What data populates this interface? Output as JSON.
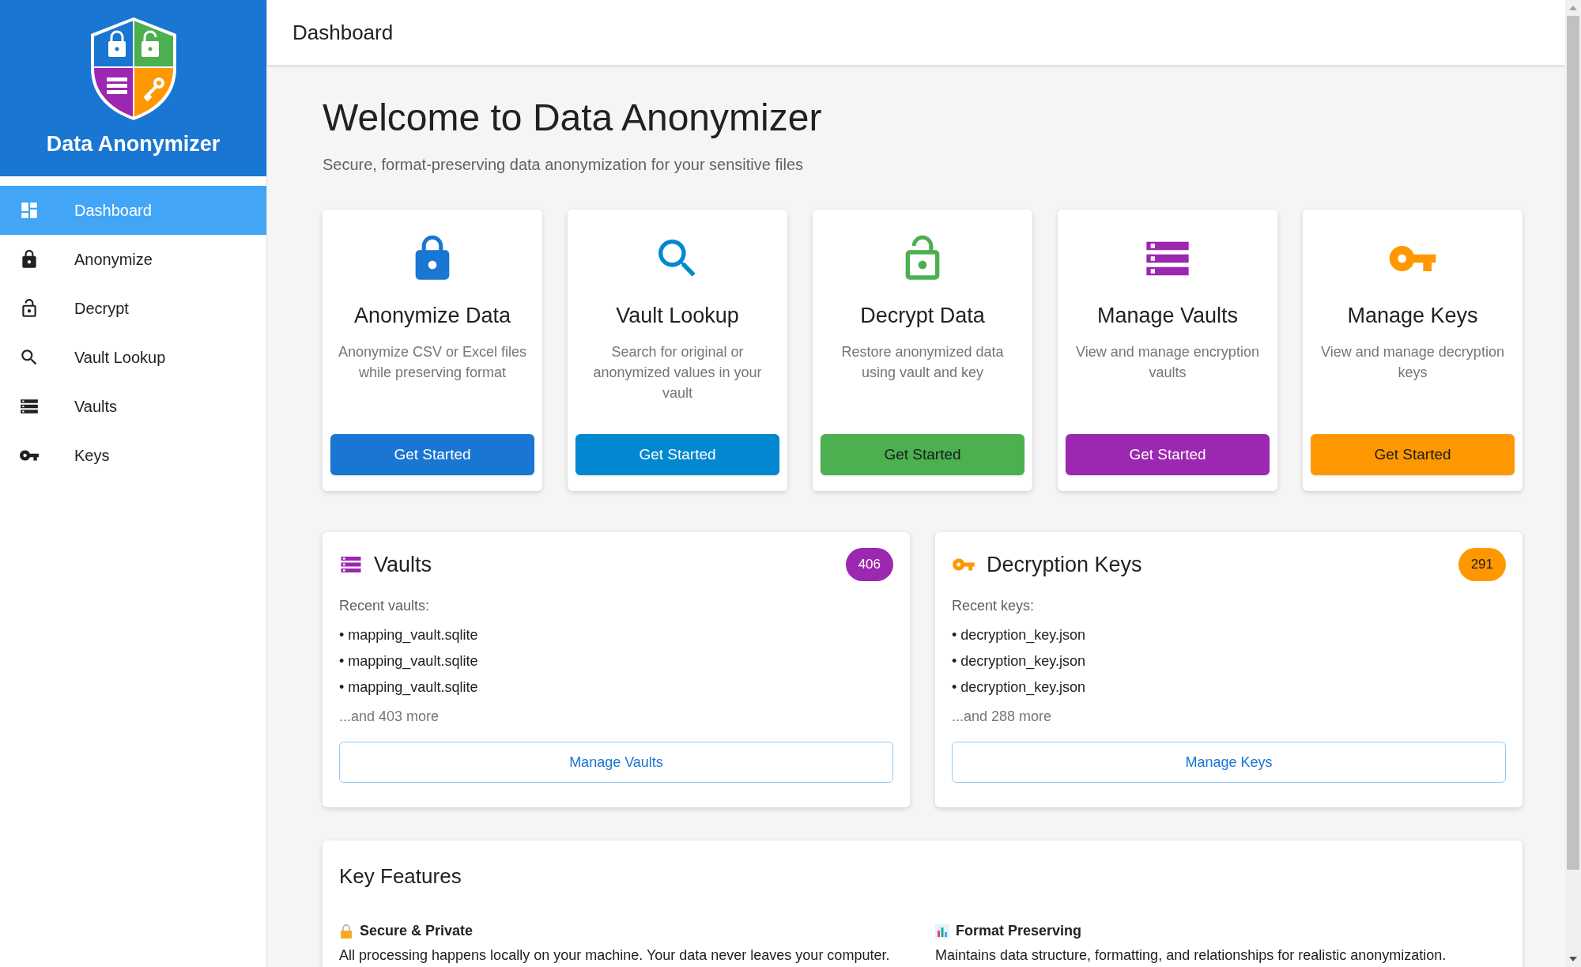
{
  "app": {
    "name": "Data Anonymizer"
  },
  "sidebar": {
    "items": [
      {
        "label": "Dashboard",
        "selected": true
      },
      {
        "label": "Anonymize",
        "selected": false
      },
      {
        "label": "Decrypt",
        "selected": false
      },
      {
        "label": "Vault Lookup",
        "selected": false
      },
      {
        "label": "Vaults",
        "selected": false
      },
      {
        "label": "Keys",
        "selected": false
      }
    ]
  },
  "header": {
    "title": "Dashboard"
  },
  "welcome": {
    "title": "Welcome to Data Anonymizer",
    "subtitle": "Secure, format-preserving data anonymization for your sensitive files"
  },
  "cards": [
    {
      "title": "Anonymize Data",
      "description": "Anonymize CSV or Excel files while preserving format",
      "button": "Get Started",
      "color": "#1976d2"
    },
    {
      "title": "Vault Lookup",
      "description": "Search for original or anonymized values in your vault",
      "button": "Get Started",
      "color": "#0288d1"
    },
    {
      "title": "Decrypt Data",
      "description": "Restore anonymized data using vault and key",
      "button": "Get Started",
      "color": "#4caf50"
    },
    {
      "title": "Manage Vaults",
      "description": "View and manage encryption vaults",
      "button": "Get Started",
      "color": "#9c27b0"
    },
    {
      "title": "Manage Keys",
      "description": "View and manage decryption keys",
      "button": "Get Started",
      "color": "#ff9800"
    }
  ],
  "panels": [
    {
      "title": "Vaults",
      "count": "406",
      "color": "#9c27b0",
      "recent_label": "Recent vaults:",
      "items": [
        "• mapping_vault.sqlite",
        "• mapping_vault.sqlite",
        "• mapping_vault.sqlite"
      ],
      "more": "...and 403 more",
      "button": "Manage Vaults"
    },
    {
      "title": "Decryption Keys",
      "count": "291",
      "color": "#ff9800",
      "recent_label": "Recent keys:",
      "items": [
        "• decryption_key.json",
        "• decryption_key.json",
        "• decryption_key.json"
      ],
      "more": "...and 288 more",
      "button": "Manage Keys"
    }
  ],
  "features": {
    "title": "Key Features",
    "items": [
      {
        "title": "Secure & Private",
        "description": "All processing happens locally on your machine. Your data never leaves your computer."
      },
      {
        "title": "Format Preserving",
        "description": "Maintains data structure, formatting, and relationships for realistic anonymization."
      }
    ]
  }
}
